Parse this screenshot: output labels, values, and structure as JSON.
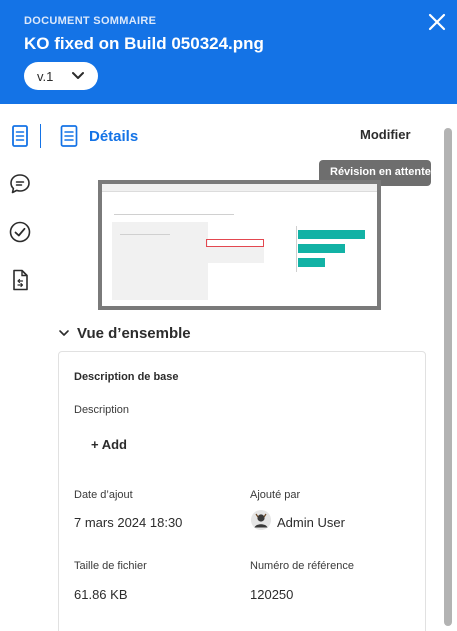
{
  "header": {
    "eyebrow": "DOCUMENT SOMMAIRE",
    "title": "KO fixed on Build 050324.png",
    "version": "v.1",
    "close_icon": "close-icon"
  },
  "rail": {
    "icons": [
      "document-icon",
      "comment-icon",
      "checkmark-circle-icon",
      "file-link-icon"
    ]
  },
  "panel": {
    "title": "Détails",
    "edit_label": "Modifier",
    "tooltip": "Révision en attente"
  },
  "overview": {
    "section_title": "Vue d’ensemble",
    "card_title": "Description de base",
    "description_label": "Description",
    "add_label": "+ Add",
    "date_added_label": "Date d’ajout",
    "date_added_value": "7 mars 2024 18:30",
    "added_by_label": "Ajouté par",
    "added_by_value": "Admin User",
    "file_size_label": "Taille de fichier",
    "file_size_value": "61.86 KB",
    "reference_label": "Numéro de référence",
    "reference_value": "120250"
  },
  "colors": {
    "accent": "#1473e6",
    "tooltip_bg": "#6e6e6e",
    "chart_teal": "#12b2a5"
  }
}
